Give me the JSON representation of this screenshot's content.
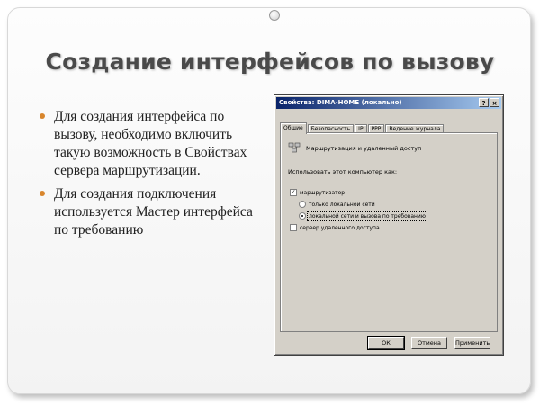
{
  "slide": {
    "title": "Создание интерфейсов по вызову",
    "bullets": [
      "Для создания интерфейса по вызову, необходимо включить такую возможность в Свойствах сервера маршрутизации.",
      "Для создания подключения используется Мастер интерфейса по требованию"
    ],
    "accent_color": "#d8862d"
  },
  "dialog": {
    "title": "Свойства: DIMA-HOME (локально)",
    "help_button": "?",
    "close_button": "×",
    "tabs": [
      "Общие",
      "Безопасность",
      "IP",
      "PPP",
      "Ведение журнала"
    ],
    "active_tab": "Общие",
    "heading": "Маршрутизация и удаленный доступ",
    "heading_icon": "server-icon",
    "use_label": "Использовать этот компьютер как:",
    "router_checkbox": {
      "label": "маршрутизатор",
      "checked": true
    },
    "radio_lan": {
      "label": "только локальной сети",
      "selected": false
    },
    "radio_demand": {
      "label": "локальной сети и вызова по требованию",
      "selected": true
    },
    "ras_checkbox": {
      "label": "сервер удаленного доступа",
      "checked": false
    },
    "buttons": {
      "ok": "ОК",
      "cancel": "Отмена",
      "apply": "Применить"
    },
    "check_mark": "✓"
  }
}
